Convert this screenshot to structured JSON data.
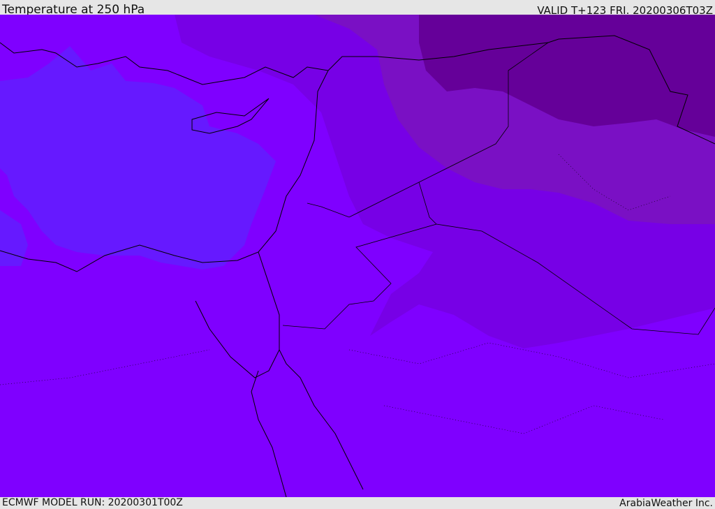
{
  "header": {
    "title": "Temperature at 250 hPa",
    "valid": "VALID T+123 FRI. 20200306T03Z"
  },
  "footer": {
    "model_run": "ECMWF MODEL RUN: 20200301T00Z",
    "credit": "ArabiaWeather Inc."
  },
  "colors": {
    "base": "#7f00ff",
    "sea_cool": "#6619ff",
    "warm1": "#7700e6",
    "warm2": "#7a10c4",
    "warm3": "#650099"
  }
}
